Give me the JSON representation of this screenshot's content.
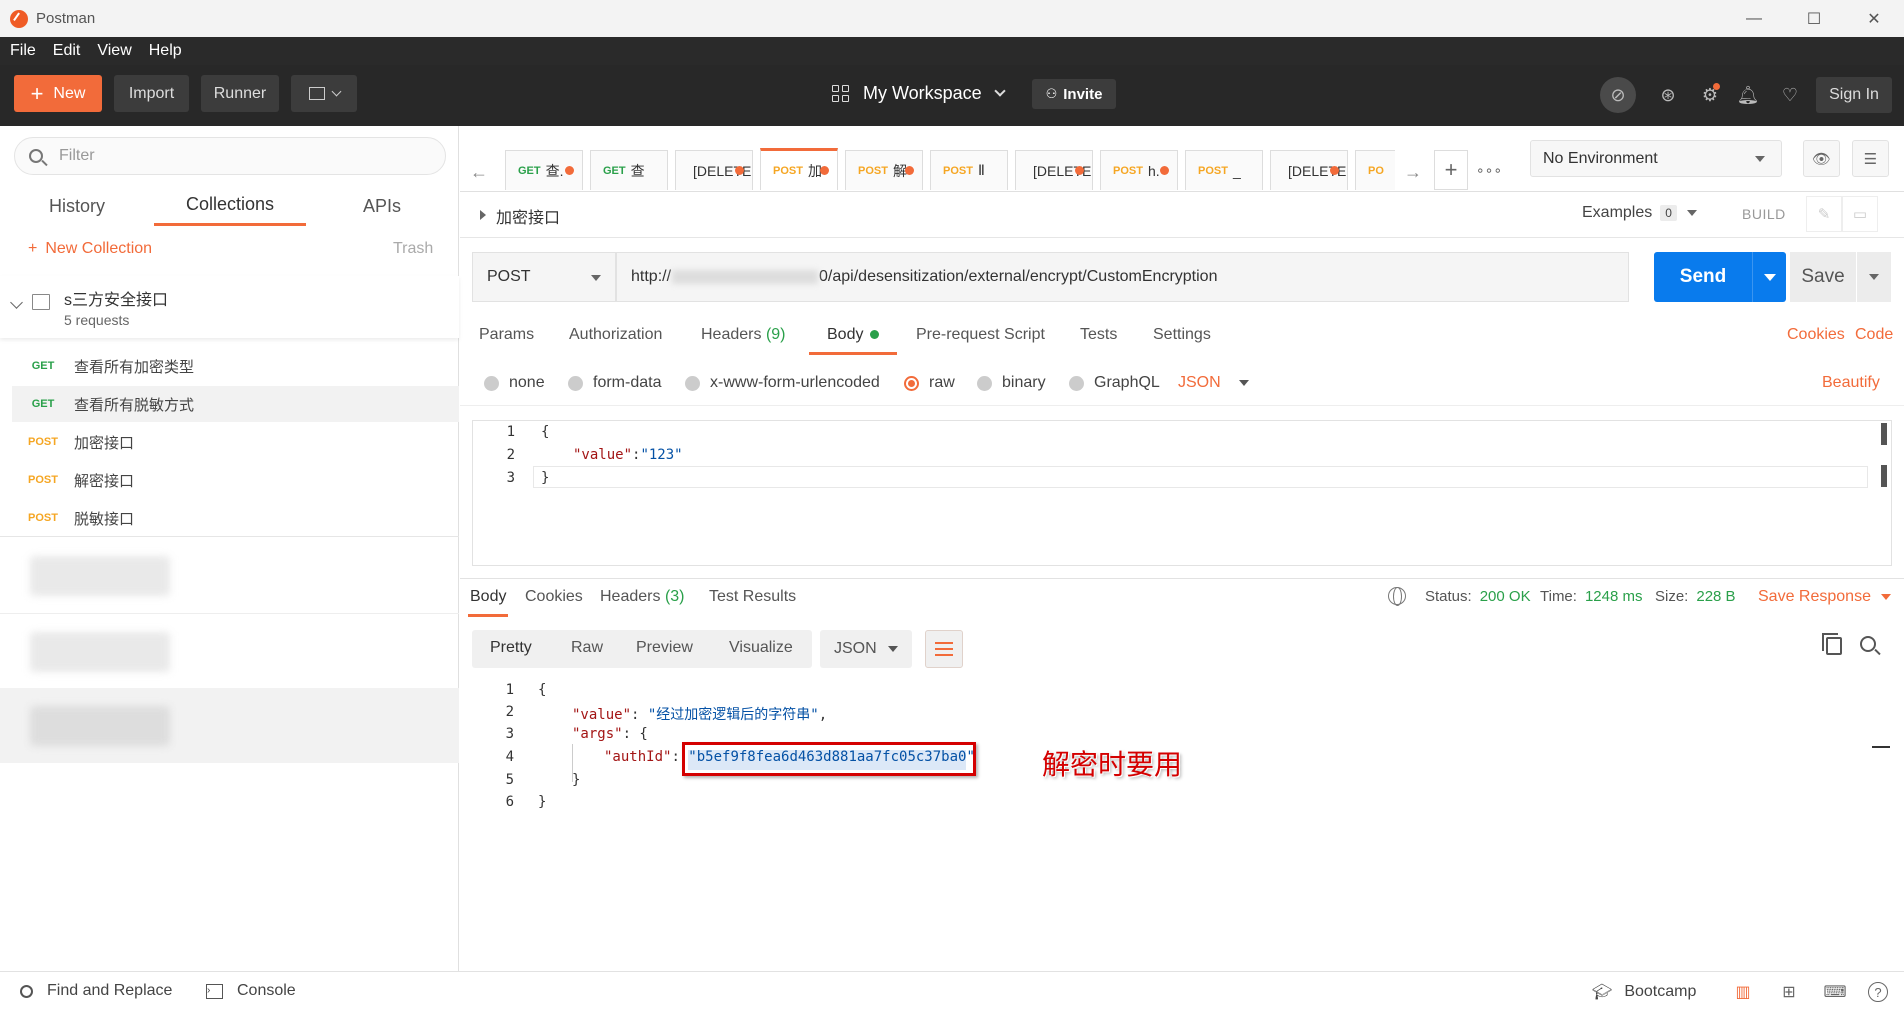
{
  "window": {
    "title": "Postman"
  },
  "menu": {
    "file": "File",
    "edit": "Edit",
    "view": "View",
    "help": "Help"
  },
  "header": {
    "new_label": "New",
    "import_label": "Import",
    "runner_label": "Runner",
    "workspace_label": "My Workspace",
    "invite_label": "Invite",
    "signin_label": "Sign In"
  },
  "sidebar": {
    "filter_placeholder": "Filter",
    "tabs": [
      "History",
      "Collections",
      "APIs"
    ],
    "new_collection": "New Collection",
    "trash": "Trash",
    "collection": {
      "name": "s三方安全接口",
      "count": "5 requests"
    },
    "requests": [
      {
        "method": "GET",
        "name": "查看所有加密类型"
      },
      {
        "method": "GET",
        "name": "查看所有脱敏方式"
      },
      {
        "method": "POST",
        "name": "加密接口"
      },
      {
        "method": "POST",
        "name": "解密接口"
      },
      {
        "method": "POST",
        "name": "脱敏接口"
      }
    ]
  },
  "tabs": [
    {
      "method": "GET",
      "label": "查."
    },
    {
      "method": "GET",
      "label": "查"
    },
    {
      "method": "",
      "label": "[DELETE"
    },
    {
      "method": "POST",
      "label": "加"
    },
    {
      "method": "POST",
      "label": "解"
    },
    {
      "method": "POST",
      "label": "Ⅱ"
    },
    {
      "method": "",
      "label": "[DELETE"
    },
    {
      "method": "POST",
      "label": "h."
    },
    {
      "method": "POST",
      "label": "_"
    },
    {
      "method": "",
      "label": "[DELETE"
    },
    {
      "method": "PO",
      "label": ""
    }
  ],
  "environment": {
    "selected": "No Environment"
  },
  "request": {
    "title": "加密接口",
    "examples_label": "Examples",
    "examples_count": "0",
    "build_label": "BUILD",
    "method": "POST",
    "url_prefix": "http://",
    "url_suffix": "0/api/desensitization/external/encrypt/CustomEncryption",
    "send_label": "Send",
    "save_label": "Save",
    "tabs": {
      "params": "Params",
      "authorization": "Authorization",
      "headers": "Headers",
      "headers_count": "(9)",
      "body": "Body",
      "prerequest": "Pre-request Script",
      "tests": "Tests",
      "settings": "Settings"
    },
    "cookies_link": "Cookies",
    "code_link": "Code",
    "body_modes": [
      "none",
      "form-data",
      "x-www-form-urlencoded",
      "raw",
      "binary",
      "GraphQL"
    ],
    "body_format": "JSON",
    "beautify": "Beautify",
    "body_lines": [
      "{",
      "\"value\"",
      ":",
      "\"123\"",
      "}"
    ]
  },
  "response": {
    "tabs": {
      "body": "Body",
      "cookies": "Cookies",
      "headers": "Headers",
      "headers_count": "(3)",
      "tests": "Test Results"
    },
    "status_label": "Status:",
    "status_value": "200 OK",
    "time_label": "Time:",
    "time_value": "1248 ms",
    "size_label": "Size:",
    "size_value": "228 B",
    "save_response": "Save Response",
    "formats": [
      "Pretty",
      "Raw",
      "Preview",
      "Visualize"
    ],
    "lang": "JSON",
    "json": {
      "value_key": "\"value\"",
      "value_str": "\"经过加密逻辑后的字符串\"",
      "args_key": "\"args\"",
      "authid_key": "\"authId\"",
      "authid_val": "\"b5ef9f8fea6d463d881aa7fc05c37ba0\""
    },
    "annotation": "解密时要用"
  },
  "footer": {
    "find_replace": "Find and Replace",
    "console": "Console",
    "bootcamp": "Bootcamp"
  },
  "colors": {
    "accent": "#f26b3a",
    "send_blue": "#097bed",
    "green": "#2aa04a",
    "annotation_red": "#d40000"
  }
}
